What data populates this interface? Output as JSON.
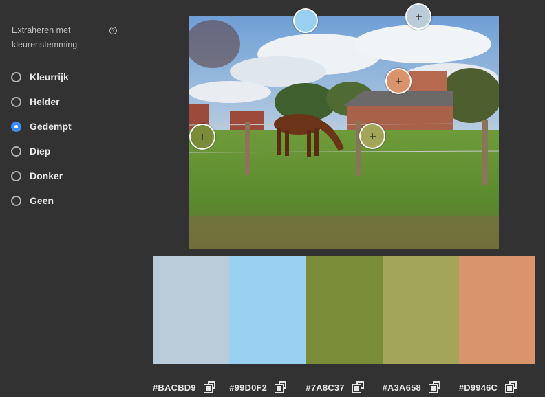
{
  "sidebar": {
    "title": "Extraheren met kleurenstemming",
    "help_icon": "?",
    "options": [
      {
        "label": "Kleurrijk",
        "selected": false
      },
      {
        "label": "Helder",
        "selected": false
      },
      {
        "label": "Gedempt",
        "selected": true
      },
      {
        "label": "Diep",
        "selected": false
      },
      {
        "label": "Donker",
        "selected": false
      },
      {
        "label": "Geen",
        "selected": false
      }
    ]
  },
  "palette": {
    "swatches": [
      {
        "hex": "#BACBD9",
        "color": "#BACBD9"
      },
      {
        "hex": "#99D0F2",
        "color": "#99D0F2"
      },
      {
        "hex": "#7A8C37",
        "color": "#7A8C37"
      },
      {
        "hex": "#A3A658",
        "color": "#A3A658"
      },
      {
        "hex": "#D9946C",
        "color": "#D9946C"
      }
    ]
  },
  "icons": {
    "copy": "copy-icon",
    "help": "help-icon",
    "marker": "plus-icon"
  }
}
